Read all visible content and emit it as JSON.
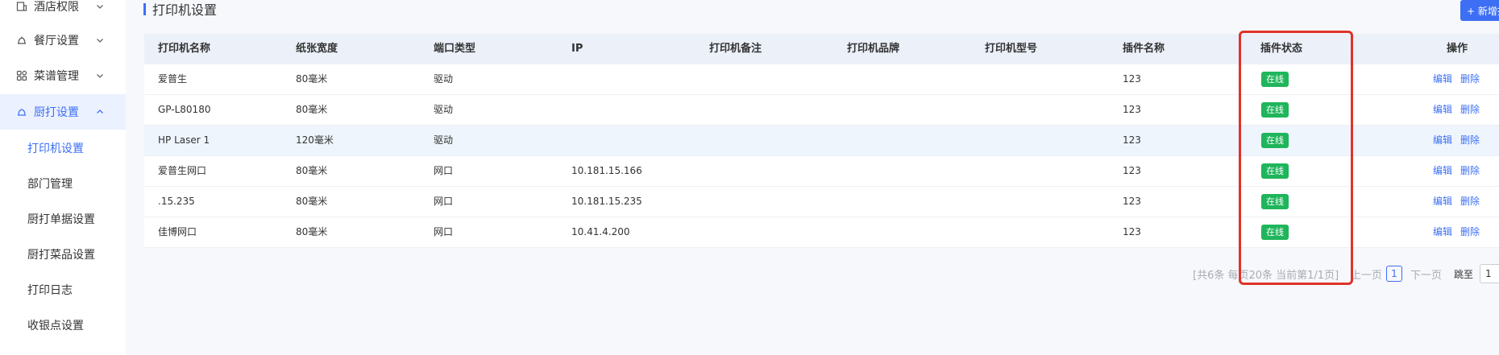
{
  "sidebar": {
    "top_items": [
      {
        "label": "酒店权限",
        "icon": "hotel-icon"
      },
      {
        "label": "餐厅设置",
        "icon": "restaurant-icon"
      },
      {
        "label": "菜谱管理",
        "icon": "grid-icon"
      },
      {
        "label": "厨打设置",
        "icon": "printer-icon"
      }
    ],
    "sub_items": [
      {
        "label": "打印机设置"
      },
      {
        "label": "部门管理"
      },
      {
        "label": "厨打单据设置"
      },
      {
        "label": "厨打菜品设置"
      },
      {
        "label": "打印日志"
      },
      {
        "label": "收银点设置"
      }
    ]
  },
  "header": {
    "title": "打印机设置",
    "add_button": "+ 新增打"
  },
  "table": {
    "columns": [
      "打印机名称",
      "纸张宽度",
      "端口类型",
      "IP",
      "打印机备注",
      "打印机品牌",
      "打印机型号",
      "插件名称",
      "插件状态",
      "操作"
    ],
    "rows": [
      {
        "name": "爱普生",
        "width": "80毫米",
        "port": "驱动",
        "ip": "",
        "remark": "",
        "brand": "",
        "model": "",
        "plugin": "123",
        "status": "在线"
      },
      {
        "name": "GP-L80180",
        "width": "80毫米",
        "port": "驱动",
        "ip": "",
        "remark": "",
        "brand": "",
        "model": "",
        "plugin": "123",
        "status": "在线"
      },
      {
        "name": "HP Laser 1",
        "width": "120毫米",
        "port": "驱动",
        "ip": "",
        "remark": "",
        "brand": "",
        "model": "",
        "plugin": "123",
        "status": "在线"
      },
      {
        "name": "爱普生网口",
        "width": "80毫米",
        "port": "网口",
        "ip": "10.181.15.166",
        "remark": "",
        "brand": "",
        "model": "",
        "plugin": "123",
        "status": "在线"
      },
      {
        "name": ".15.235",
        "width": "80毫米",
        "port": "网口",
        "ip": "10.181.15.235",
        "remark": "",
        "brand": "",
        "model": "",
        "plugin": "123",
        "status": "在线"
      },
      {
        "name": "佳博网口",
        "width": "80毫米",
        "port": "网口",
        "ip": "10.41.4.200",
        "remark": "",
        "brand": "",
        "model": "",
        "plugin": "123",
        "status": "在线"
      }
    ],
    "edit_label": "编辑",
    "delete_label": "删除"
  },
  "pagination": {
    "info": "[共6条 每页20条 当前第1/1页]",
    "prev": "上一页",
    "current_page": "1",
    "next": "下一页",
    "jump_label": "跳至",
    "jump_value": "1"
  },
  "colors": {
    "accent": "#3d6ff5",
    "status_online": "#1fb55b",
    "annotation": "#e0322a"
  }
}
